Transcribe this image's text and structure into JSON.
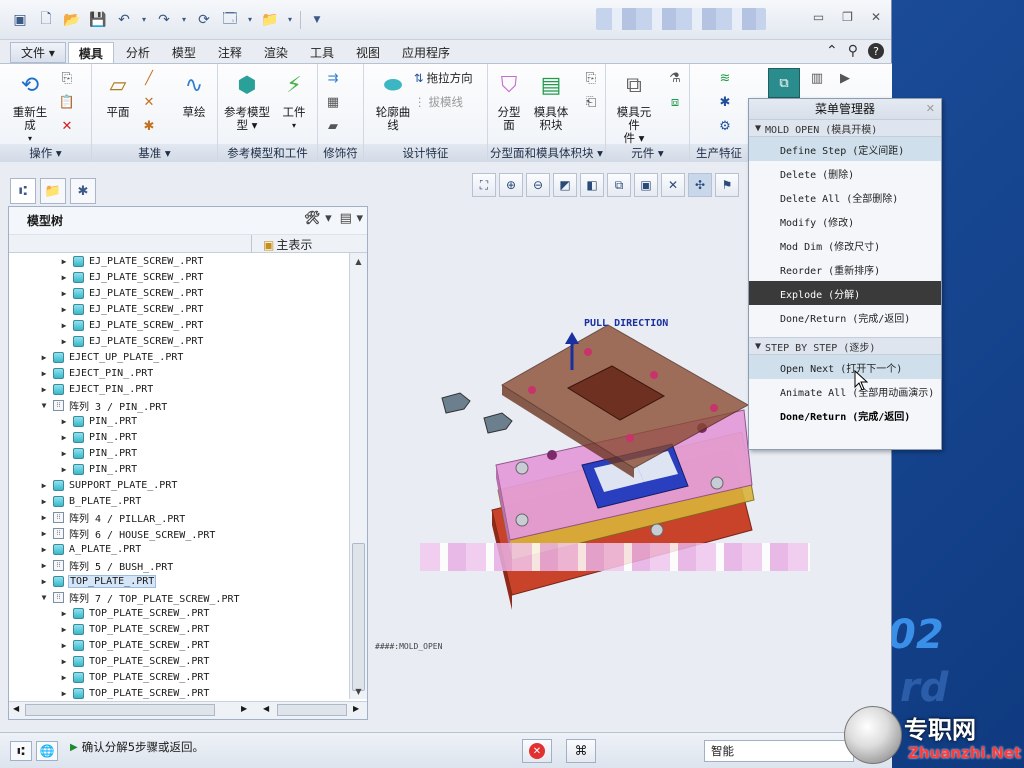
{
  "quick_access": {
    "icons": [
      "app-icon",
      "new-icon",
      "open-icon",
      "save-icon",
      "undo-icon",
      "redo-icon",
      "regenerate-icon",
      "windows-icon",
      "folder-icon",
      "customize-icon"
    ]
  },
  "tabs": [
    "文件",
    "模具",
    "分析",
    "模型",
    "注释",
    "渲染",
    "工具",
    "视图",
    "应用程序"
  ],
  "active_tab": "模具",
  "ribbon": {
    "groups": {
      "operations": "操作",
      "datum": "基准",
      "ref_model": "参考模型和工件",
      "modifiers": "修饰符",
      "design_feature": "设计特征",
      "parting": "分型面和模具体积块",
      "components": "元件",
      "production": "生产特征"
    },
    "buttons": {
      "regenerate": "重新生成",
      "plane": "平面",
      "sketch": "草绘",
      "ref_model": "参考模型",
      "workpiece": "工件",
      "contour_curve": "轮廓曲线",
      "drag_direction": "拖拉方向",
      "draft_line": "拔模线",
      "parting_surface": "分型面",
      "mold_volume": "模具体积块",
      "mold_component": "模具元件"
    }
  },
  "model_tree": {
    "title": "模型树",
    "column_header": "主表示",
    "rows": [
      {
        "indent": 2,
        "type": "part",
        "name": "EJ_PLATE_SCREW_.PRT"
      },
      {
        "indent": 2,
        "type": "part",
        "name": "EJ_PLATE_SCREW_.PRT"
      },
      {
        "indent": 2,
        "type": "part",
        "name": "EJ_PLATE_SCREW_.PRT"
      },
      {
        "indent": 2,
        "type": "part",
        "name": "EJ_PLATE_SCREW_.PRT"
      },
      {
        "indent": 2,
        "type": "part",
        "name": "EJ_PLATE_SCREW_.PRT"
      },
      {
        "indent": 2,
        "type": "part",
        "name": "EJ_PLATE_SCREW_.PRT"
      },
      {
        "indent": 1,
        "type": "part",
        "name": "EJECT_UP_PLATE_.PRT"
      },
      {
        "indent": 1,
        "type": "part",
        "name": "EJECT_PIN_.PRT"
      },
      {
        "indent": 1,
        "type": "part",
        "name": "EJECT_PIN_.PRT"
      },
      {
        "indent": 1,
        "type": "array",
        "name": "阵列 3 / PIN_.PRT",
        "expanded": true
      },
      {
        "indent": 2,
        "type": "part",
        "name": "PIN_.PRT"
      },
      {
        "indent": 2,
        "type": "part",
        "name": "PIN_.PRT"
      },
      {
        "indent": 2,
        "type": "part",
        "name": "PIN_.PRT"
      },
      {
        "indent": 2,
        "type": "part",
        "name": "PIN_.PRT"
      },
      {
        "indent": 1,
        "type": "part",
        "name": "SUPPORT_PLATE_.PRT"
      },
      {
        "indent": 1,
        "type": "part",
        "name": "B_PLATE_.PRT"
      },
      {
        "indent": 1,
        "type": "array",
        "name": "阵列 4 / PILLAR_.PRT"
      },
      {
        "indent": 1,
        "type": "array",
        "name": "阵列 6 / HOUSE_SCREW_.PRT"
      },
      {
        "indent": 1,
        "type": "part",
        "name": "A_PLATE_.PRT"
      },
      {
        "indent": 1,
        "type": "array",
        "name": "阵列 5 / BUSH_.PRT"
      },
      {
        "indent": 1,
        "type": "part",
        "name": "TOP_PLATE_.PRT",
        "selected": true
      },
      {
        "indent": 1,
        "type": "array",
        "name": "阵列 7 / TOP_PLATE_SCREW_.PRT",
        "expanded": true
      },
      {
        "indent": 2,
        "type": "part",
        "name": "TOP_PLATE_SCREW_.PRT"
      },
      {
        "indent": 2,
        "type": "part",
        "name": "TOP_PLATE_SCREW_.PRT"
      },
      {
        "indent": 2,
        "type": "part",
        "name": "TOP_PLATE_SCREW_.PRT"
      },
      {
        "indent": 2,
        "type": "part",
        "name": "TOP_PLATE_SCREW_.PRT"
      },
      {
        "indent": 2,
        "type": "part",
        "name": "TOP_PLATE_SCREW_.PRT"
      },
      {
        "indent": 2,
        "type": "part",
        "name": "TOP_PLATE_SCREW_.PRT"
      }
    ]
  },
  "viewport": {
    "pull_direction": "PULL DIRECTION",
    "model_label": "####:MOLD_OPEN"
  },
  "menu_manager": {
    "title": "菜单管理器",
    "section1": "MOLD OPEN (模具开模)",
    "items1": [
      {
        "label": "Define Step (定义间距)",
        "state": "hl"
      },
      {
        "label": "Delete (删除)",
        "state": ""
      },
      {
        "label": "Delete All (全部删除)",
        "state": ""
      },
      {
        "label": "Modify (修改)",
        "state": ""
      },
      {
        "label": "Mod Dim (修改尺寸)",
        "state": ""
      },
      {
        "label": "Reorder (重新排序)",
        "state": ""
      },
      {
        "label": "Explode (分解)",
        "state": "dark"
      },
      {
        "label": "Done/Return (完成/返回)",
        "state": ""
      }
    ],
    "section2": "STEP BY STEP (逐步)",
    "items2": [
      {
        "label": "Open Next (打开下一个)",
        "state": "hl"
      },
      {
        "label": "Animate All (全部用动画演示)",
        "state": ""
      },
      {
        "label": "Done/Return (完成/返回)",
        "state": "bold"
      }
    ]
  },
  "status": {
    "message": "确认分解5步骤或返回。",
    "filter": "智能"
  },
  "desktop": {
    "big_text": "02",
    "rd_text": "rd",
    "watermark_cn": "专职网",
    "watermark_url": "Zhuanzhi.Net"
  }
}
